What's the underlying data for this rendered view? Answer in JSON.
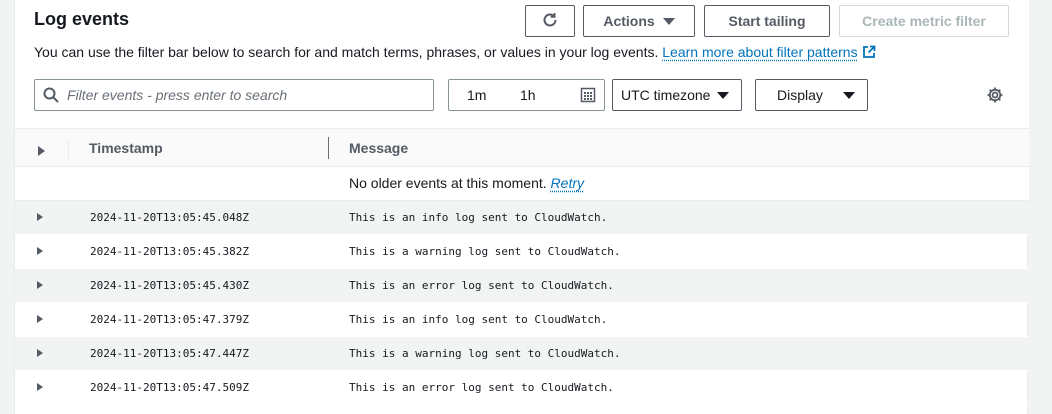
{
  "header": {
    "title": "Log events",
    "description": "You can use the filter bar below to search for and match terms, phrases, or values in your log events.",
    "learn_more_link": "Learn more about filter patterns"
  },
  "toolbar": {
    "refresh_icon": "refresh-icon",
    "actions_label": "Actions",
    "start_tailing_label": "Start tailing",
    "create_metric_filter_label": "Create metric filter"
  },
  "filter": {
    "search_placeholder": "Filter events - press enter to search",
    "range_1m": "1m",
    "range_1h": "1h",
    "timezone_label": "UTC timezone",
    "display_label": "Display"
  },
  "table": {
    "columns": {
      "timestamp": "Timestamp",
      "message": "Message"
    },
    "notice_text": "No older events at this moment.",
    "notice_retry": "Retry",
    "rows": [
      {
        "timestamp": "2024-11-20T13:05:45.048Z",
        "message": "This is an info log sent to CloudWatch."
      },
      {
        "timestamp": "2024-11-20T13:05:45.382Z",
        "message": "This is a warning log sent to CloudWatch."
      },
      {
        "timestamp": "2024-11-20T13:05:45.430Z",
        "message": "This is an error log sent to CloudWatch."
      },
      {
        "timestamp": "2024-11-20T13:05:47.379Z",
        "message": "This is an info log sent to CloudWatch."
      },
      {
        "timestamp": "2024-11-20T13:05:47.447Z",
        "message": "This is a warning log sent to CloudWatch."
      },
      {
        "timestamp": "2024-11-20T13:05:47.509Z",
        "message": "This is an error log sent to CloudWatch."
      }
    ]
  },
  "colors": {
    "link": "#0073bb",
    "text": "#16191f",
    "row_alt": "#f2f3f3",
    "border": "#545b64"
  }
}
